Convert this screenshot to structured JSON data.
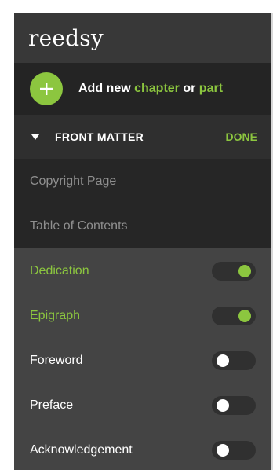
{
  "header": {
    "logo_text": "reedsy"
  },
  "add_row": {
    "prefix": "Add new ",
    "chapter_link": "chapter",
    "or_text": " or ",
    "part_link": "part",
    "accent_color": "#8cc63f"
  },
  "section": {
    "title": "FRONT MATTER",
    "done_label": "DONE",
    "expanded": true
  },
  "fixed_items": [
    {
      "label": "Copyright Page"
    },
    {
      "label": "Table of Contents"
    }
  ],
  "toggle_items": [
    {
      "label": "Dedication",
      "enabled": true
    },
    {
      "label": "Epigraph",
      "enabled": true
    },
    {
      "label": "Foreword",
      "enabled": false
    },
    {
      "label": "Preface",
      "enabled": false
    },
    {
      "label": "Acknowledgement",
      "enabled": false
    }
  ]
}
